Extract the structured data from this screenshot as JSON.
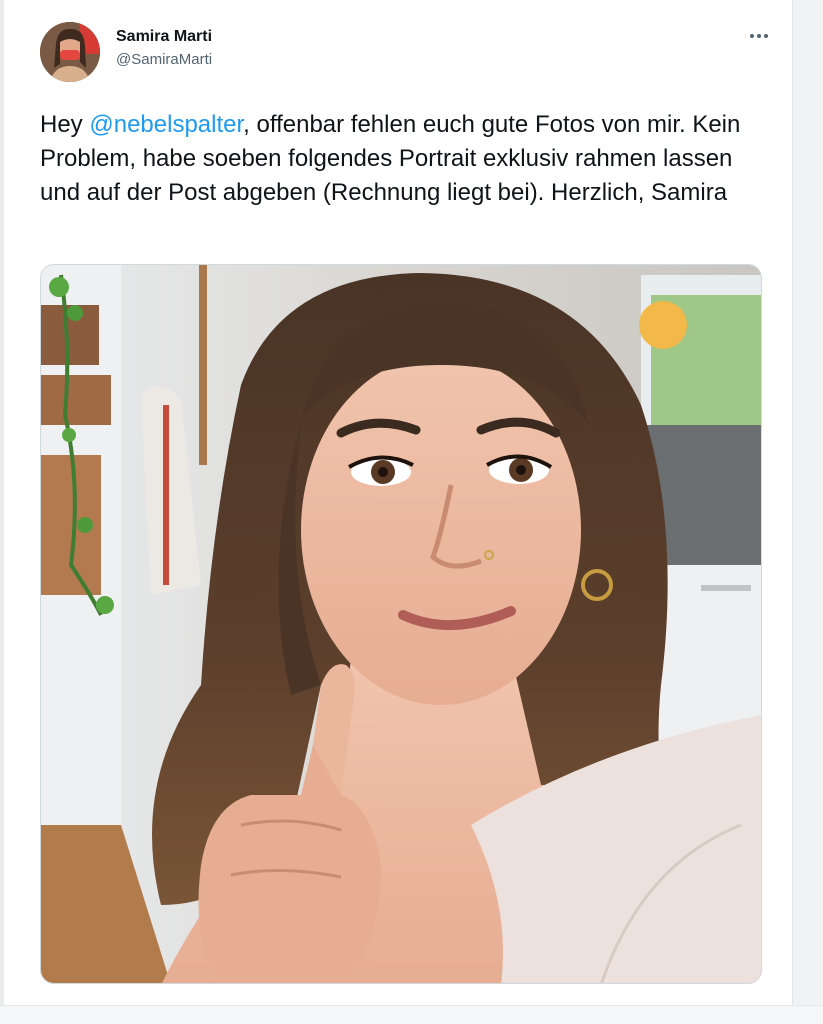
{
  "author": {
    "display_name": "Samira Marti",
    "handle": "@SamiraMarti",
    "avatar_icon": "profile-photo"
  },
  "more_menu": {
    "icon": "more-horizontal-icon"
  },
  "tweet": {
    "text_before_mention": "Hey ",
    "mention": "@nebelspalter",
    "text_after_mention": ", offenbar fehlen euch gute Fotos von mir. Kein Problem, habe soeben folgendes Portrait exklusiv rahmen lassen und auf der Post abgeben (Rechnung liegt bei). Herzlich, Samira"
  },
  "colors": {
    "mention": "#1d9bf0",
    "text": "#0f1419",
    "secondary": "#536471"
  }
}
